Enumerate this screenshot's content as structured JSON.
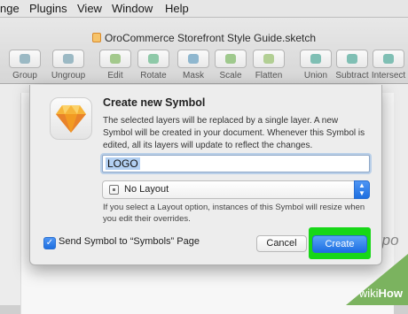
{
  "menu": {
    "items": [
      "nge",
      "Plugins",
      "View",
      "Window",
      "Help"
    ]
  },
  "window": {
    "title": "OroCommerce Storefront Style Guide.sketch"
  },
  "toolbar": {
    "tools": [
      {
        "label": "Group",
        "icon": "group-icon"
      },
      {
        "label": "Ungroup",
        "icon": "ungroup-icon"
      },
      {
        "label": "Edit",
        "icon": "edit-icon"
      },
      {
        "label": "Rotate",
        "icon": "rotate-icon"
      },
      {
        "label": "Mask",
        "icon": "mask-icon"
      },
      {
        "label": "Scale",
        "icon": "scale-icon"
      },
      {
        "label": "Flatten",
        "icon": "flatten-icon"
      },
      {
        "label": "Union",
        "icon": "union-icon"
      },
      {
        "label": "Subtract",
        "icon": "subtract-icon"
      },
      {
        "label": "Intersect",
        "icon": "intersect-icon"
      }
    ]
  },
  "canvas": {
    "background_text": "rpo"
  },
  "dialog": {
    "title": "Create new Symbol",
    "description": "The selected layers will be replaced by a single layer. A new Symbol will be created in your document. Whenever this Symbol is edited, all its layers will update to reflect the changes.",
    "name_value": "LOGO",
    "layout_value": "No Layout",
    "hint": "If you select a Layout option, instances of this Symbol will resize when you edit their overrides.",
    "checkbox_label": "Send Symbol to “Symbols” Page",
    "checkbox_checked": true,
    "cancel_label": "Cancel",
    "create_label": "Create"
  },
  "colors": {
    "accent": "#1e6fe0",
    "highlight": "#17d717",
    "watermark": "#7bb35f"
  },
  "watermark": {
    "brand": "wiki",
    "brand_suffix": "How"
  }
}
